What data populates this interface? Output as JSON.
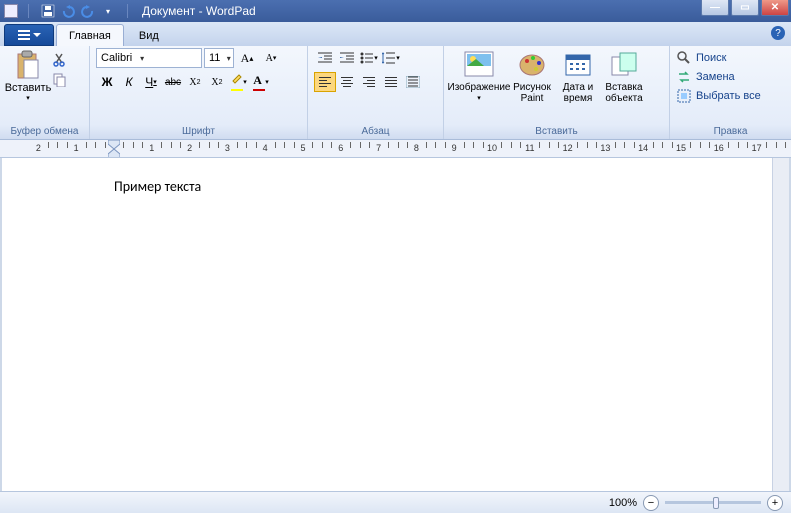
{
  "title": "Документ - WordPad",
  "tabs": {
    "main": "Главная",
    "view": "Вид"
  },
  "groups": {
    "clipboard": {
      "paste": "Вставить",
      "label": "Буфер обмена"
    },
    "font": {
      "name": "Calibri",
      "size": "11",
      "label": "Шрифт",
      "bold": "Ж",
      "italic": "К",
      "underline": "Ч",
      "strike": "abc"
    },
    "paragraph": {
      "label": "Абзац"
    },
    "insert": {
      "image": "Изображение",
      "paint": "Рисунок Paint",
      "datetime": "Дата и время",
      "object": "Вставка объекта",
      "label": "Вставить"
    },
    "editing": {
      "find": "Поиск",
      "replace": "Замена",
      "selectall": "Выбрать все",
      "label": "Правка"
    }
  },
  "document": {
    "text": "Пример текста"
  },
  "status": {
    "zoom": "100%"
  },
  "ruler": {
    "start": -2,
    "end": 17
  }
}
